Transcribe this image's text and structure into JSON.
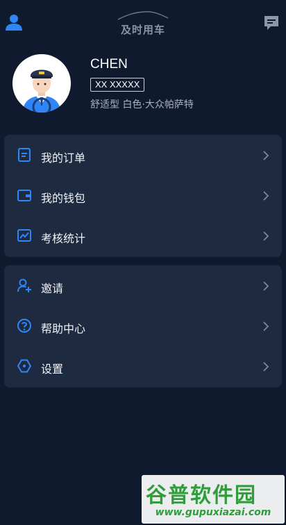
{
  "header": {
    "brand_name": "及时用车",
    "left_icon": "user-icon",
    "right_icon": "message-icon"
  },
  "profile": {
    "name": "CHEN",
    "plate": "XX XXXXX",
    "car_description": "舒适型 白色·大众帕萨特",
    "avatar": "driver-avatar"
  },
  "menu_primary": [
    {
      "label": "我的订单",
      "icon": "order-icon"
    },
    {
      "label": "我的钱包",
      "icon": "wallet-icon"
    },
    {
      "label": "考核统计",
      "icon": "statistics-icon"
    }
  ],
  "menu_secondary": [
    {
      "label": "邀请",
      "icon": "invite-user-icon"
    },
    {
      "label": "帮助中心",
      "icon": "help-icon"
    },
    {
      "label": "设置",
      "icon": "settings-icon"
    }
  ],
  "watermark": {
    "title": "谷普软件园",
    "url": "www.gupuxiazai.com"
  },
  "colors": {
    "background": "#0f1a2e",
    "card": "#1e2a40",
    "accent": "#2f86f6",
    "watermark_green": "#2f9d3a"
  }
}
